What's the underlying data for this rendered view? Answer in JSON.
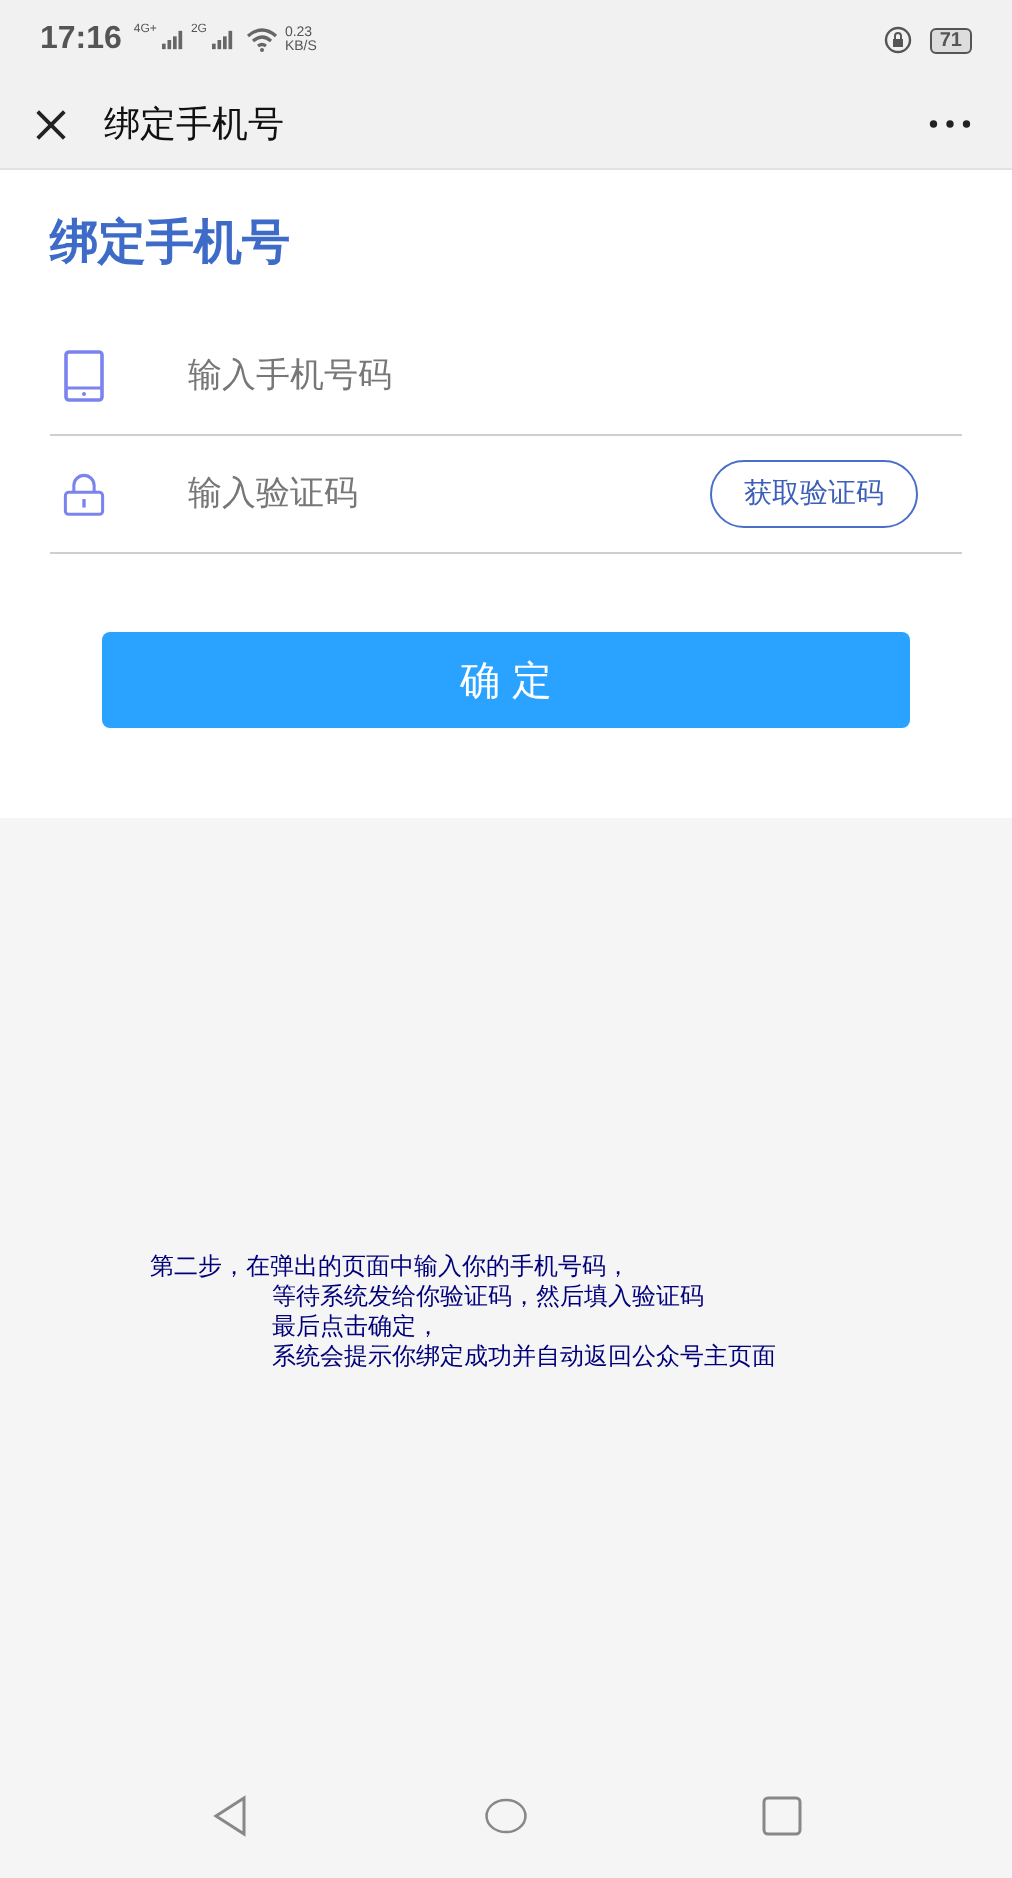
{
  "status_bar": {
    "time": "17:16",
    "signal_labels": [
      "4G+",
      "2G"
    ],
    "net_speed": [
      "0.23",
      "KB/S"
    ],
    "battery": "71"
  },
  "nav_bar": {
    "title": "绑定手机号"
  },
  "form": {
    "heading": "绑定手机号",
    "fields": [
      {
        "kind": "phone",
        "placeholder": "输入手机号码"
      },
      {
        "kind": "code",
        "placeholder": "输入验证码",
        "button": "获取验证码"
      }
    ],
    "submit": "确 定"
  },
  "instructions": [
    {
      "text": "第二步，在弹出的页面中输入你的手机号码，",
      "indent": false
    },
    {
      "text": "等待系统发给你验证码，然后填入验证码",
      "indent": true
    },
    {
      "text": "最后点击确定，",
      "indent": true
    },
    {
      "text": "系统会提示你绑定成功并自动返回公众号主页面",
      "indent": true
    }
  ]
}
